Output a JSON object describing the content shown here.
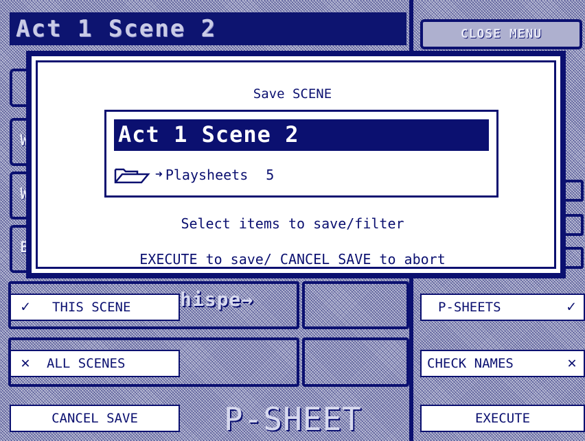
{
  "header": {
    "scene_title": "Act 1 Scene 2",
    "close_menu_label": "CLOSE MENU"
  },
  "left_stubs": [
    "W",
    "W",
    "B"
  ],
  "dialog": {
    "title": "Save SCENE",
    "scene_name": "Act 1 Scene 2",
    "folder_label": "Playsheets",
    "folder_count": "5",
    "hint_select": "Select items to save/filter",
    "hint_execute": "EXECUTE to save/ CANCEL SAVE to abort"
  },
  "behind_text": {
    "whisper": "hispe",
    "psheet": "P-SHEET"
  },
  "buttons": {
    "this_scene": {
      "mark": "✓",
      "label": "THIS SCENE"
    },
    "all_scenes": {
      "mark": "✕",
      "label": "ALL SCENES"
    },
    "cancel_save": {
      "label": "CANCEL SAVE"
    },
    "p_sheets": {
      "label": "P-SHEETS",
      "mark": "✓"
    },
    "check_names": {
      "label": "CHECK NAMES",
      "mark": "✕"
    },
    "execute": {
      "label": "EXECUTE"
    }
  },
  "colors": {
    "accent": "#0b1070",
    "dialog_bg": "#ffffff",
    "hatch": "#bfc1d8"
  }
}
